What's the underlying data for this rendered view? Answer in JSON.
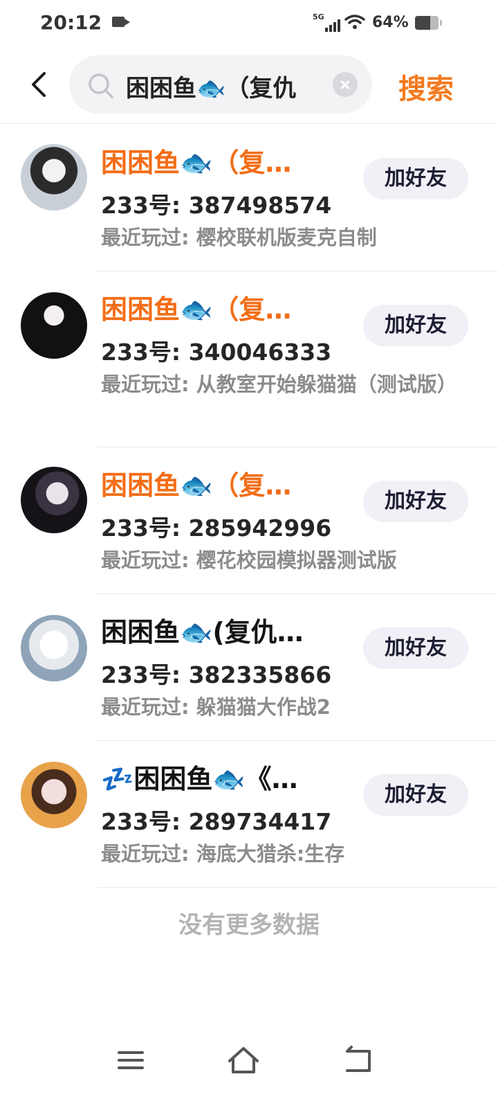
{
  "status_bar": {
    "time": "20:12",
    "network": "5G",
    "battery_percent": "64%",
    "battery_level": 0.64
  },
  "search": {
    "back_icon": "chevron-left-icon",
    "query": "困困鱼🐟（复仇",
    "button_label": "搜索",
    "accent_color": "#f47a1f"
  },
  "results": [
    {
      "name": "困困鱼🐟（复…",
      "name_color": "orange",
      "uid": "233号: 387498574",
      "played": "最近玩过: 樱校联机版麦克自制",
      "action": "加好友"
    },
    {
      "name": "困困鱼🐟（复…",
      "name_color": "orange",
      "uid": "233号: 340046333",
      "played": "最近玩过: 从教室开始躲猫猫（测试版）",
      "action": "加好友"
    },
    {
      "name": "困困鱼🐟（复…",
      "name_color": "orange",
      "uid": "233号: 285942996",
      "played": "最近玩过: 樱花校园模拟器测试版",
      "action": "加好友"
    },
    {
      "name": "困困鱼🐟(复仇…",
      "name_color": "dark",
      "uid": "233号: 382335866",
      "played": "最近玩过: 躲猫猫大作战2",
      "action": "加好友"
    },
    {
      "name": "💤困困鱼🐟《…",
      "name_color": "dark",
      "uid": "233号: 289734417",
      "played": "最近玩过: 海底大猎杀:生存",
      "action": "加好友"
    }
  ],
  "footer_text": "没有更多数据",
  "nav": {
    "menu_icon": "menu-icon",
    "home_icon": "home-icon",
    "back_icon": "back-icon"
  }
}
